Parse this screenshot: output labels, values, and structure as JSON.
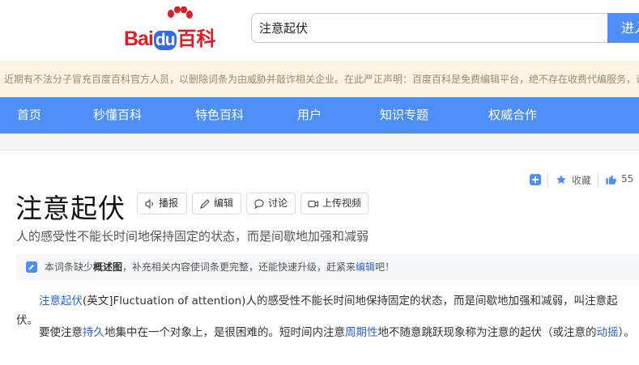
{
  "header": {
    "logo_bai": "Bai",
    "logo_du": "du",
    "logo_baike": "百科",
    "search_value": "注意起伏",
    "search_button": "进入"
  },
  "notice": {
    "text": "近期有不法分子冒充百度百科官方人员，以删除词条为由威胁并敲诈相关企业。在此严正声明：百度百科是免费编辑平台，绝不存在收费代编服务，请"
  },
  "nav": {
    "items": [
      "首页",
      "秒懂百科",
      "特色百科",
      "用户",
      "知识专题",
      "权威合作"
    ]
  },
  "actions": {
    "favorite_label": "收藏",
    "like_count": "55"
  },
  "entry": {
    "title": "注意起伏",
    "tools": [
      "播报",
      "编辑",
      "讨论",
      "上传视频"
    ],
    "subtitle": "人的感受性不能长时间地保持固定的状态，而是间歇地加强和减弱"
  },
  "tip": {
    "pre": "本词条缺少",
    "bold": "概述图",
    "mid": "，补充相关内容使词条更完整，还能快速升级，赶紧来",
    "link": "编辑",
    "post": "吧！"
  },
  "content": {
    "p1_link": "注意起伏",
    "p1_text": "(英文]Fluctuation of attention)人的感受性不能长时间地保持固定的状态，而是间歇地加强和减弱，叫注意起伏。",
    "p2_a": "要使注意",
    "p2_link1": "持久",
    "p2_b": "地集中在一个对象上，是很困难的。短时间内注意",
    "p2_link2": "周期性",
    "p2_c": "地不随意跳跃现象称为注意的起伏（或注意的",
    "p2_link3": "动摇",
    "p2_d": "）。"
  },
  "colors": {
    "brand_red": "#de1e26",
    "brand_blue": "#4e8ef7",
    "link_blue": "#2a66d8"
  }
}
